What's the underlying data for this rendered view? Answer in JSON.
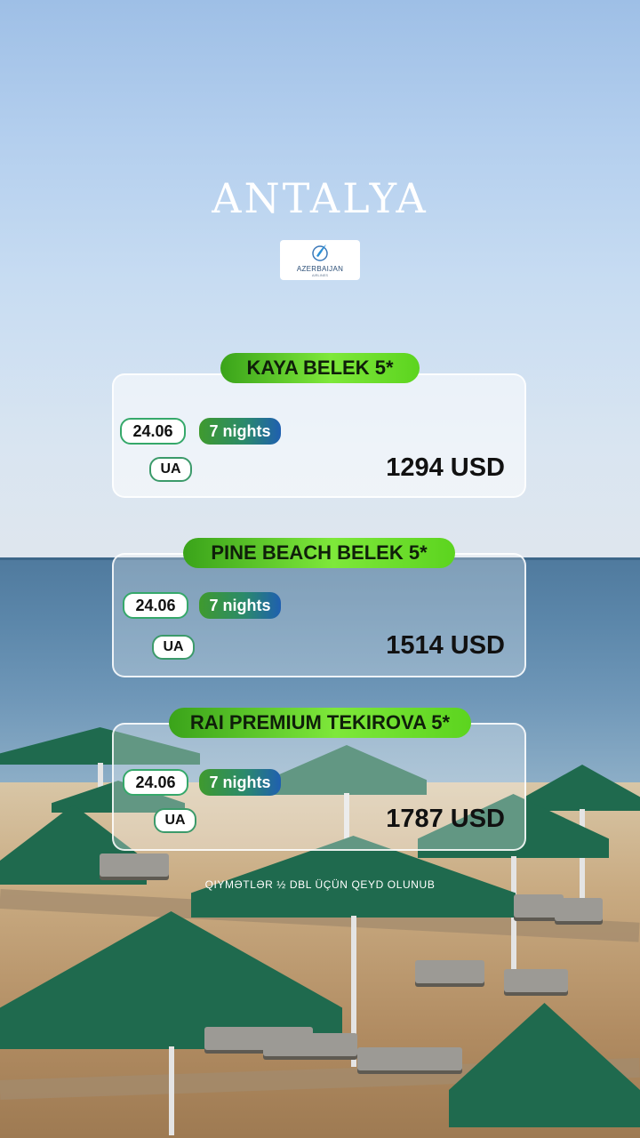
{
  "destination": "ANTALYA",
  "airline": {
    "name": "AZERBAIJAN",
    "sub": "AIRLINES",
    "logo_icon": "wing-logo-icon"
  },
  "offers": [
    {
      "hotel": "KAYA BELEK 5*",
      "date": "24.06",
      "nights": "7 nights",
      "board": "UA",
      "price": "1294 USD"
    },
    {
      "hotel": "PINE BEACH BELEK 5*",
      "date": "24.06",
      "nights": "7 nights",
      "board": "UA",
      "price": "1514 USD"
    },
    {
      "hotel": "RAI PREMIUM TEKIROVA 5*",
      "date": "24.06",
      "nights": "7 nights",
      "board": "UA",
      "price": "1787 USD"
    }
  ],
  "footnote": "QIYMƏTLƏR ½ DBL ÜÇÜN QEYD OLUNUB",
  "colors": {
    "hotel_pill": "#5cd41f",
    "nights_start": "#3f9a2e",
    "nights_end": "#1f5fb0",
    "umbrella": "#1f6a4e"
  }
}
